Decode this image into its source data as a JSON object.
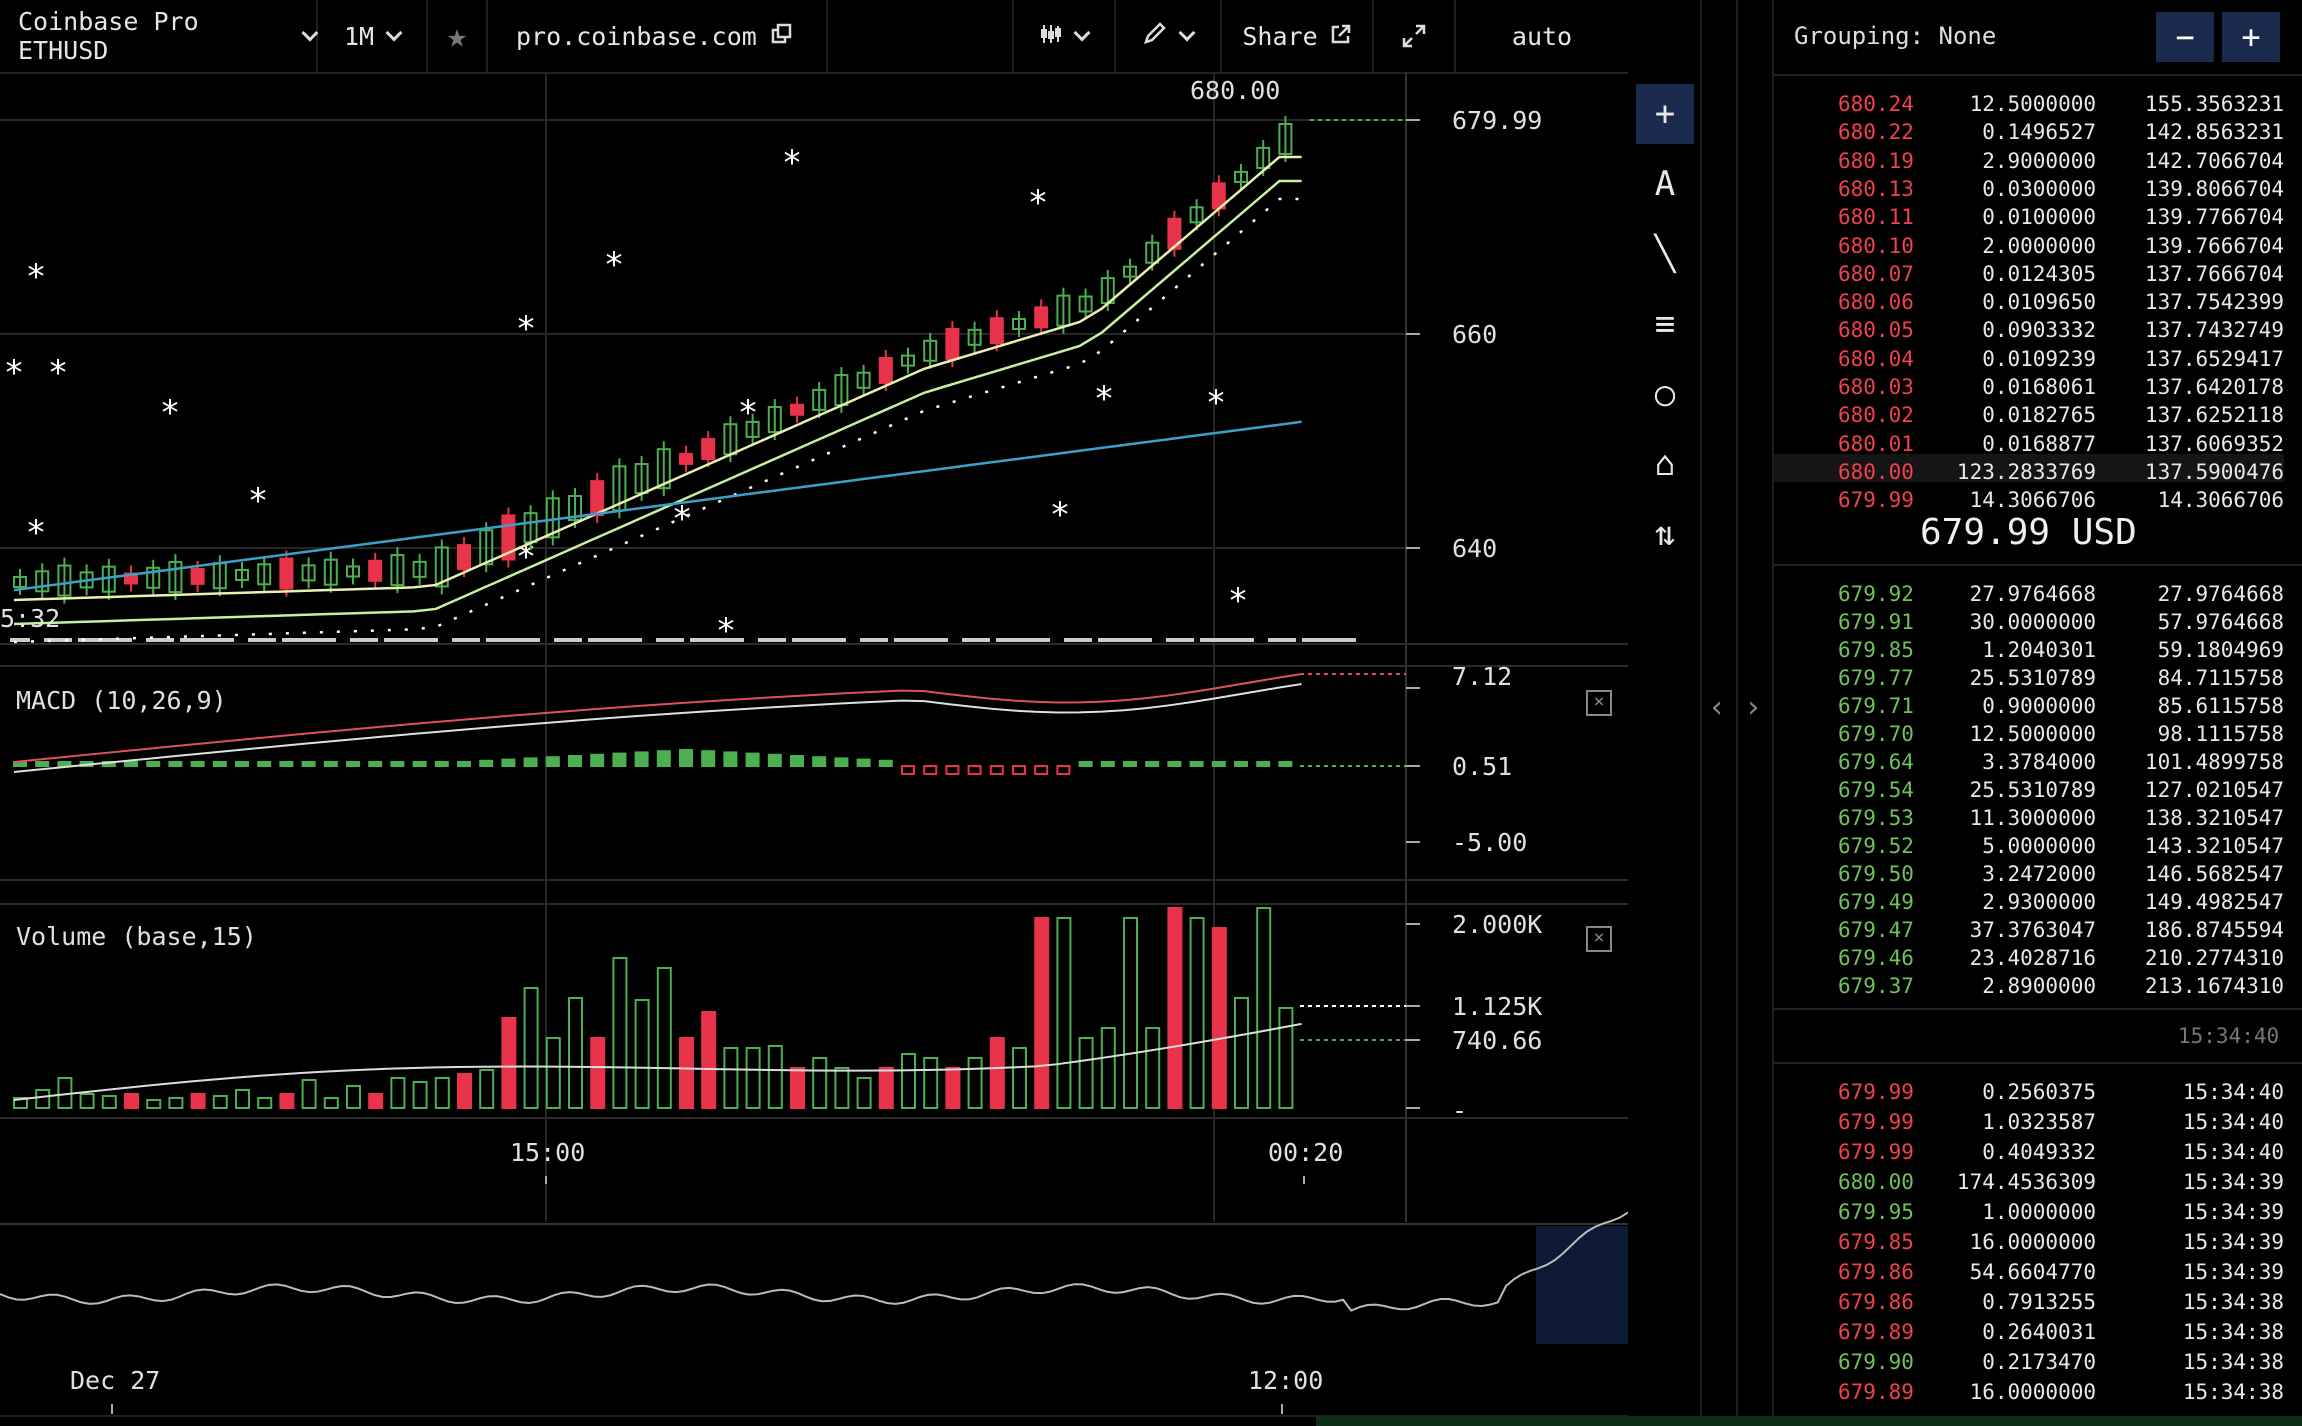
{
  "toolbar": {
    "symbol": "Coinbase Pro ETHUSD",
    "interval": "1M",
    "favorite_icon": "star-icon",
    "site": "pro.coinbase.com",
    "copy_icon": "copy-icon",
    "chart_type_icon": "candles-icon",
    "draw_icon": "pencil-icon",
    "share_label": "Share",
    "share_icon": "external-link-icon",
    "fullscreen_icon": "expand-icon",
    "scale_mode": "auto"
  },
  "chart": {
    "price_labels": [
      "679.99",
      "660",
      "640"
    ],
    "last_high_label": "680.00",
    "left_cut_label": "5:32",
    "macd_title": "MACD (10,26,9)",
    "macd_labels": [
      "7.12",
      "0.51",
      "-5.00"
    ],
    "volume_title": "Volume (base,15)",
    "volume_labels": [
      "2.000K",
      "1.125K",
      "740.66",
      "-"
    ],
    "time_labels": [
      "15:00",
      "00:20"
    ],
    "overview_labels": [
      "Dec 27",
      "12:00"
    ],
    "colors": {
      "up": "#4caf50",
      "down": "#e8334a",
      "ma_fast": "#e9f0b0",
      "ma_mid": "#c5f0a0",
      "ma_slow": "#3aa0c8"
    }
  },
  "draw_tools": [
    {
      "name": "crosshair-icon",
      "glyph": "+"
    },
    {
      "name": "text-tool-icon",
      "glyph": "A"
    },
    {
      "name": "line-tool-icon",
      "glyph": "╲"
    },
    {
      "name": "fib-tool-icon",
      "glyph": "≡"
    },
    {
      "name": "circle-tool-icon",
      "glyph": "○"
    },
    {
      "name": "measure-tool-icon",
      "glyph": "⌂"
    },
    {
      "name": "move-tool-icon",
      "glyph": "⇅"
    }
  ],
  "panel_nav": {
    "prev": "‹",
    "next": "›"
  },
  "orderbook": {
    "grouping_label": "Grouping: None",
    "minus": "−",
    "plus": "+",
    "asks": [
      [
        "680.24",
        "12.5000000",
        "155.3563231"
      ],
      [
        "680.22",
        "0.1496527",
        "142.8563231"
      ],
      [
        "680.19",
        "2.9000000",
        "142.7066704"
      ],
      [
        "680.13",
        "0.0300000",
        "139.8066704"
      ],
      [
        "680.11",
        "0.0100000",
        "139.7766704"
      ],
      [
        "680.10",
        "2.0000000",
        "139.7666704"
      ],
      [
        "680.07",
        "0.0124305",
        "137.7666704"
      ],
      [
        "680.06",
        "0.0109650",
        "137.7542399"
      ],
      [
        "680.05",
        "0.0903332",
        "137.7432749"
      ],
      [
        "680.04",
        "0.0109239",
        "137.6529417"
      ],
      [
        "680.03",
        "0.0168061",
        "137.6420178"
      ],
      [
        "680.02",
        "0.0182765",
        "137.6252118"
      ],
      [
        "680.01",
        "0.0168877",
        "137.6069352"
      ],
      [
        "680.00",
        "123.2833769",
        "137.5900476"
      ],
      [
        "679.99",
        "14.3066706",
        "14.3066706"
      ]
    ],
    "mid_price": "679.99 USD",
    "bids": [
      [
        "679.92",
        "27.9764668",
        "27.9764668"
      ],
      [
        "679.91",
        "30.0000000",
        "57.9764668"
      ],
      [
        "679.85",
        "1.2040301",
        "59.1804969"
      ],
      [
        "679.77",
        "25.5310789",
        "84.7115758"
      ],
      [
        "679.71",
        "0.9000000",
        "85.6115758"
      ],
      [
        "679.70",
        "12.5000000",
        "98.1115758"
      ],
      [
        "679.64",
        "3.3784000",
        "101.4899758"
      ],
      [
        "679.54",
        "25.5310789",
        "127.0210547"
      ],
      [
        "679.53",
        "11.3000000",
        "138.3210547"
      ],
      [
        "679.52",
        "5.0000000",
        "143.3210547"
      ],
      [
        "679.50",
        "3.2472000",
        "146.5682547"
      ],
      [
        "679.49",
        "2.9300000",
        "149.4982547"
      ],
      [
        "679.47",
        "37.3763047",
        "186.8745594"
      ],
      [
        "679.46",
        "23.4028716",
        "210.2774310"
      ],
      [
        "679.37",
        "2.8900000",
        "213.1674310"
      ]
    ],
    "trade_header_time": "15:34:40",
    "trades": [
      [
        "679.99",
        "0.2560375",
        "15:34:40",
        "red"
      ],
      [
        "679.99",
        "1.0323587",
        "15:34:40",
        "red"
      ],
      [
        "679.99",
        "0.4049332",
        "15:34:40",
        "red"
      ],
      [
        "680.00",
        "174.4536309",
        "15:34:39",
        "green"
      ],
      [
        "679.95",
        "1.0000000",
        "15:34:39",
        "green"
      ],
      [
        "679.85",
        "16.0000000",
        "15:34:39",
        "red"
      ],
      [
        "679.86",
        "54.6604770",
        "15:34:39",
        "red"
      ],
      [
        "679.86",
        "0.7913255",
        "15:34:38",
        "red"
      ],
      [
        "679.89",
        "0.2640031",
        "15:34:38",
        "red"
      ],
      [
        "679.90",
        "0.2173470",
        "15:34:38",
        "green"
      ],
      [
        "679.89",
        "16.0000000",
        "15:34:38",
        "red"
      ]
    ]
  }
}
